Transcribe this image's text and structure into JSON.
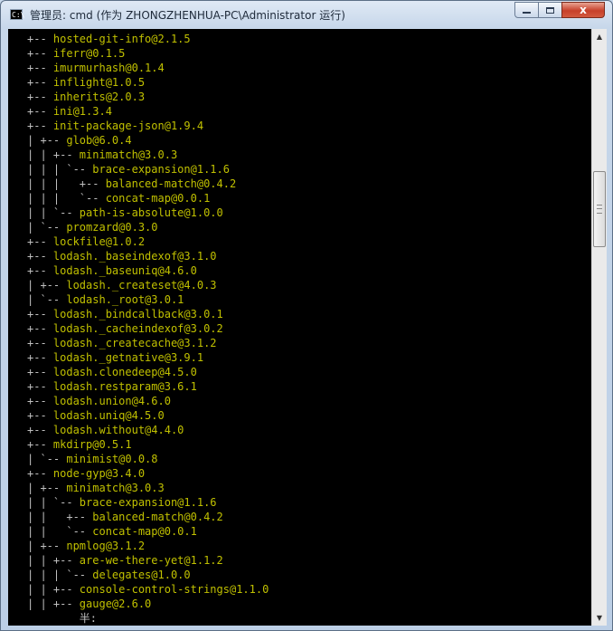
{
  "window": {
    "title": "管理员: cmd (作为 ZHONGZHENHUA-PC\\Administrator 运行)",
    "app_icon_text": "C:\\",
    "controls": {
      "minimize": "minimize",
      "maximize": "maximize",
      "close": "x"
    }
  },
  "console": {
    "lines": [
      {
        "prefix": "+-- ",
        "text": "hosted-git-info@2.1.5"
      },
      {
        "prefix": "+-- ",
        "text": "iferr@0.1.5"
      },
      {
        "prefix": "+-- ",
        "text": "imurmurhash@0.1.4"
      },
      {
        "prefix": "+-- ",
        "text": "inflight@1.0.5"
      },
      {
        "prefix": "+-- ",
        "text": "inherits@2.0.3"
      },
      {
        "prefix": "+-- ",
        "text": "ini@1.3.4"
      },
      {
        "prefix": "+-- ",
        "text": "init-package-json@1.9.4"
      },
      {
        "prefix": "| +-- ",
        "text": "glob@6.0.4"
      },
      {
        "prefix": "| | +-- ",
        "text": "minimatch@3.0.3"
      },
      {
        "prefix": "| | | `-- ",
        "text": "brace-expansion@1.1.6"
      },
      {
        "prefix": "| | |   +-- ",
        "text": "balanced-match@0.4.2"
      },
      {
        "prefix": "| | |   `-- ",
        "text": "concat-map@0.0.1"
      },
      {
        "prefix": "| | `-- ",
        "text": "path-is-absolute@1.0.0"
      },
      {
        "prefix": "| `-- ",
        "text": "promzard@0.3.0"
      },
      {
        "prefix": "+-- ",
        "text": "lockfile@1.0.2"
      },
      {
        "prefix": "+-- ",
        "text": "lodash._baseindexof@3.1.0"
      },
      {
        "prefix": "+-- ",
        "text": "lodash._baseuniq@4.6.0"
      },
      {
        "prefix": "| +-- ",
        "text": "lodash._createset@4.0.3"
      },
      {
        "prefix": "| `-- ",
        "text": "lodash._root@3.0.1"
      },
      {
        "prefix": "+-- ",
        "text": "lodash._bindcallback@3.0.1"
      },
      {
        "prefix": "+-- ",
        "text": "lodash._cacheindexof@3.0.2"
      },
      {
        "prefix": "+-- ",
        "text": "lodash._createcache@3.1.2"
      },
      {
        "prefix": "+-- ",
        "text": "lodash._getnative@3.9.1"
      },
      {
        "prefix": "+-- ",
        "text": "lodash.clonedeep@4.5.0"
      },
      {
        "prefix": "+-- ",
        "text": "lodash.restparam@3.6.1"
      },
      {
        "prefix": "+-- ",
        "text": "lodash.union@4.6.0"
      },
      {
        "prefix": "+-- ",
        "text": "lodash.uniq@4.5.0"
      },
      {
        "prefix": "+-- ",
        "text": "lodash.without@4.4.0"
      },
      {
        "prefix": "+-- ",
        "text": "mkdirp@0.5.1"
      },
      {
        "prefix": "| `-- ",
        "text": "minimist@0.0.8"
      },
      {
        "prefix": "+-- ",
        "text": "node-gyp@3.4.0"
      },
      {
        "prefix": "| +-- ",
        "text": "minimatch@3.0.3"
      },
      {
        "prefix": "| | `-- ",
        "text": "brace-expansion@1.1.6"
      },
      {
        "prefix": "| |   +-- ",
        "text": "balanced-match@0.4.2"
      },
      {
        "prefix": "| |   `-- ",
        "text": "concat-map@0.0.1"
      },
      {
        "prefix": "| +-- ",
        "text": "npmlog@3.1.2"
      },
      {
        "prefix": "| | +-- ",
        "text": "are-we-there-yet@1.1.2"
      },
      {
        "prefix": "| | | `-- ",
        "text": "delegates@1.0.0"
      },
      {
        "prefix": "| | +-- ",
        "text": "console-control-strings@1.1.0"
      },
      {
        "prefix": "| | +-- ",
        "text": "gauge@2.6.0"
      }
    ],
    "ime_line": "        半:"
  },
  "colors": {
    "console_background": "#000000",
    "console_text": "#c0c000",
    "tree_lines": "#c0c0c0"
  },
  "icons": {
    "scroll_up": "chevron-up-icon",
    "scroll_down": "chevron-down-icon"
  }
}
